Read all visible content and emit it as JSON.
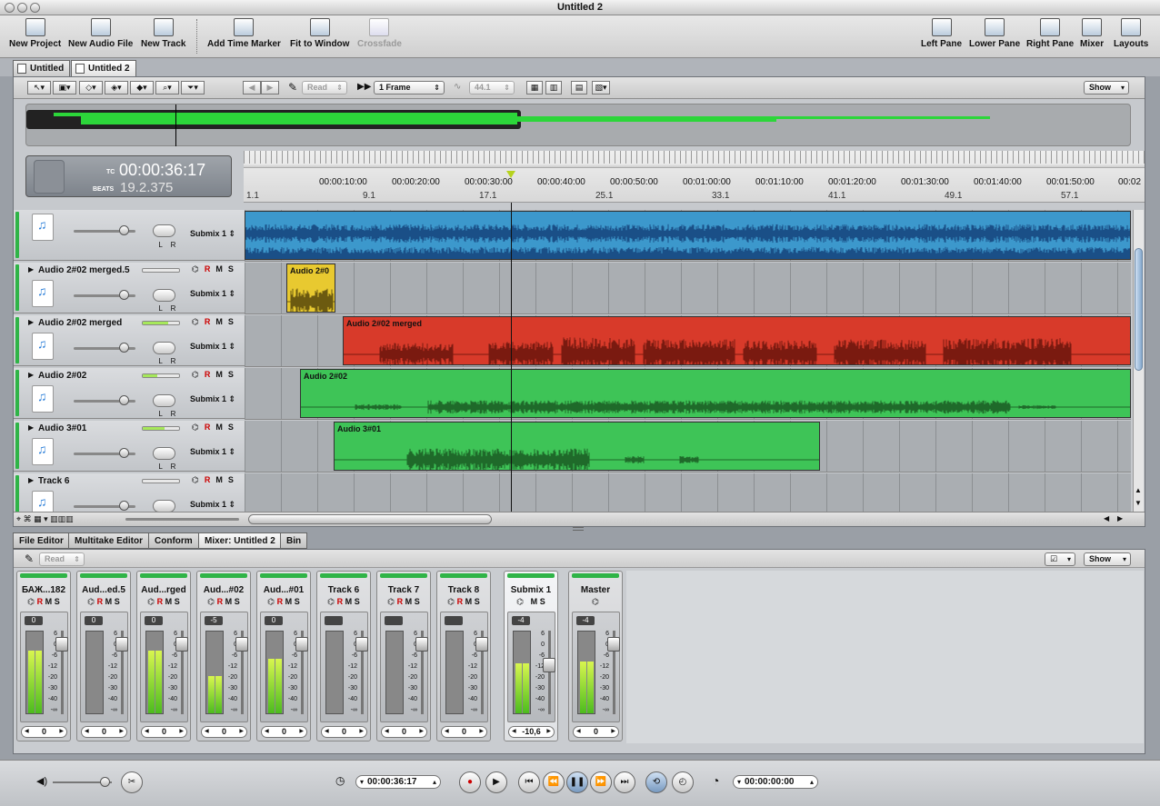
{
  "window": {
    "title": "Untitled 2"
  },
  "toolbar": {
    "left": [
      {
        "label": "New Project",
        "icon": "new-project-icon"
      },
      {
        "label": "New Audio File",
        "icon": "new-audio-file-icon"
      },
      {
        "label": "New Track",
        "icon": "new-track-icon"
      },
      {
        "label": "Add Time Marker",
        "icon": "time-marker-icon"
      },
      {
        "label": "Fit to Window",
        "icon": "fit-window-icon"
      },
      {
        "label": "Crossfade",
        "icon": "crossfade-icon",
        "disabled": true
      }
    ],
    "right": [
      {
        "label": "Left Pane",
        "icon": "left-pane-icon"
      },
      {
        "label": "Lower Pane",
        "icon": "lower-pane-icon"
      },
      {
        "label": "Right Pane",
        "icon": "right-pane-icon"
      },
      {
        "label": "Mixer",
        "icon": "mixer-icon"
      },
      {
        "label": "Layouts",
        "icon": "layouts-icon"
      }
    ]
  },
  "doc_tabs": [
    "Untitled",
    "Untitled 2"
  ],
  "editor": {
    "automation_mode": "Read",
    "snap": "1 Frame",
    "sample_rate": "44.1",
    "show_label": "Show"
  },
  "time_display": {
    "tc_label": "TC",
    "timecode": "00:00:36:17",
    "beats_label": "BEATS",
    "beats": "19.2.375"
  },
  "ruler": {
    "time_labels": [
      "00:00:10:00",
      "00:00:20:00",
      "00:00:30:00",
      "00:00:40:00",
      "00:00:50:00",
      "00:01:00:00",
      "00:01:10:00",
      "00:01:20:00",
      "00:01:30:00",
      "00:01:40:00",
      "00:01:50:00",
      "00:02"
    ],
    "beat_labels": [
      "1.1",
      "9.1",
      "17.1",
      "25.1",
      "33.1",
      "41.1",
      "49.1",
      "57.1"
    ]
  },
  "tracks": [
    {
      "name": "",
      "send": "Submix 1",
      "meter": 0,
      "rms": "",
      "clip": {
        "label": "",
        "color": "#3c98cc"
      }
    },
    {
      "name": "Audio 2#02 merged.5",
      "send": "Submix 1",
      "meter": 0,
      "rms": "R",
      "clip": {
        "label": "Audio 2#0",
        "color": "#e8c930"
      }
    },
    {
      "name": "Audio 2#02 merged",
      "send": "Submix 1",
      "meter": 0.7,
      "rms": "R",
      "clip": {
        "label": "Audio 2#02 merged",
        "color": "#d83a2a"
      }
    },
    {
      "name": "Audio 2#02",
      "send": "Submix 1",
      "meter": 0.4,
      "rms": "R",
      "clip": {
        "label": "Audio 2#02",
        "color": "#3ec457"
      }
    },
    {
      "name": "Audio 3#01",
      "send": "Submix 1",
      "meter": 0.6,
      "rms": "R",
      "clip": {
        "label": "Audio 3#01",
        "color": "#3ec457"
      }
    },
    {
      "name": "Track 6",
      "send": "Submix 1",
      "meter": 0,
      "rms": "R",
      "clip": {
        "label": "",
        "color": ""
      }
    }
  ],
  "rms_labels": {
    "r": "R",
    "m": "M",
    "s": "S"
  },
  "bottom_tabs": [
    "File Editor",
    "Multitake Editor",
    "Conform",
    "Mixer: Untitled 2",
    "Bin"
  ],
  "mixer": {
    "automation_mode": "Read",
    "show_label": "Show",
    "strips": [
      {
        "name": "БАЖ...182",
        "peak": "0",
        "pan": "0",
        "level": 0.75,
        "fader": 0.1
      },
      {
        "name": "Aud...ed.5",
        "peak": "0",
        "pan": "0",
        "level": 0,
        "fader": 0.1
      },
      {
        "name": "Aud...rged",
        "peak": "0",
        "pan": "0",
        "level": 0.75,
        "fader": 0.1
      },
      {
        "name": "Aud...#02",
        "peak": "-5",
        "pan": "0",
        "level": 0.45,
        "fader": 0.1
      },
      {
        "name": "Aud...#01",
        "peak": "0",
        "pan": "0",
        "level": 0.65,
        "fader": 0.1
      },
      {
        "name": "Track 6",
        "peak": "",
        "pan": "0",
        "level": 0,
        "fader": 0.1
      },
      {
        "name": "Track 7",
        "peak": "",
        "pan": "0",
        "level": 0,
        "fader": 0.1
      },
      {
        "name": "Track 8",
        "peak": "",
        "pan": "0",
        "level": 0,
        "fader": 0.1
      },
      {
        "name": "Submix 1",
        "peak": "-4",
        "pan": "-10,6",
        "level": 0.6,
        "fader": 0.35
      },
      {
        "name": "Master",
        "peak": "-4",
        "pan": "0",
        "level": 0.62,
        "fader": 0.1
      }
    ],
    "scale": [
      "6",
      "0",
      "-6",
      "-12",
      "-20",
      "-30",
      "-40",
      "-∞"
    ]
  },
  "transport": {
    "playhead_time": "00:00:36:17",
    "duration": "00:00:00:00"
  }
}
